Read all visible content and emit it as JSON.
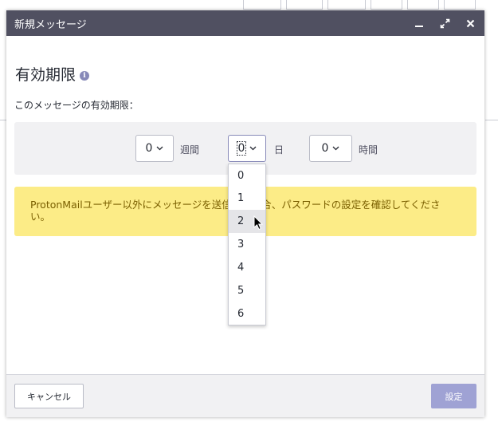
{
  "modal": {
    "title": "新規メッセージ"
  },
  "expiration": {
    "heading": "有効期限",
    "description": "このメッセージの有効期限：",
    "weeks": {
      "value": "0",
      "unit": "週間"
    },
    "days": {
      "value": "0",
      "unit": "日"
    },
    "hours": {
      "value": "0",
      "unit": "時間"
    },
    "warning": "ProtonMailユーザー以外にメッセージを送信する場合、パスワードの設定を確認してください。"
  },
  "dropdown": {
    "options": [
      "0",
      "1",
      "2",
      "3",
      "4",
      "5",
      "6"
    ],
    "hovered": "2"
  },
  "footer": {
    "cancel_label": "キャンセル",
    "set_label": "設定"
  },
  "colors": {
    "header_bg": "#505061",
    "warning_bg": "#fcec87",
    "primary_button": "#9fa2d4",
    "accent": "#8789b8"
  },
  "icons": {
    "minimize": "minimize-icon",
    "maximize": "maximize-icon",
    "close": "close-icon",
    "info": "info-icon",
    "chevron": "chevron-down-icon",
    "cursor": "mouse-cursor-icon"
  }
}
